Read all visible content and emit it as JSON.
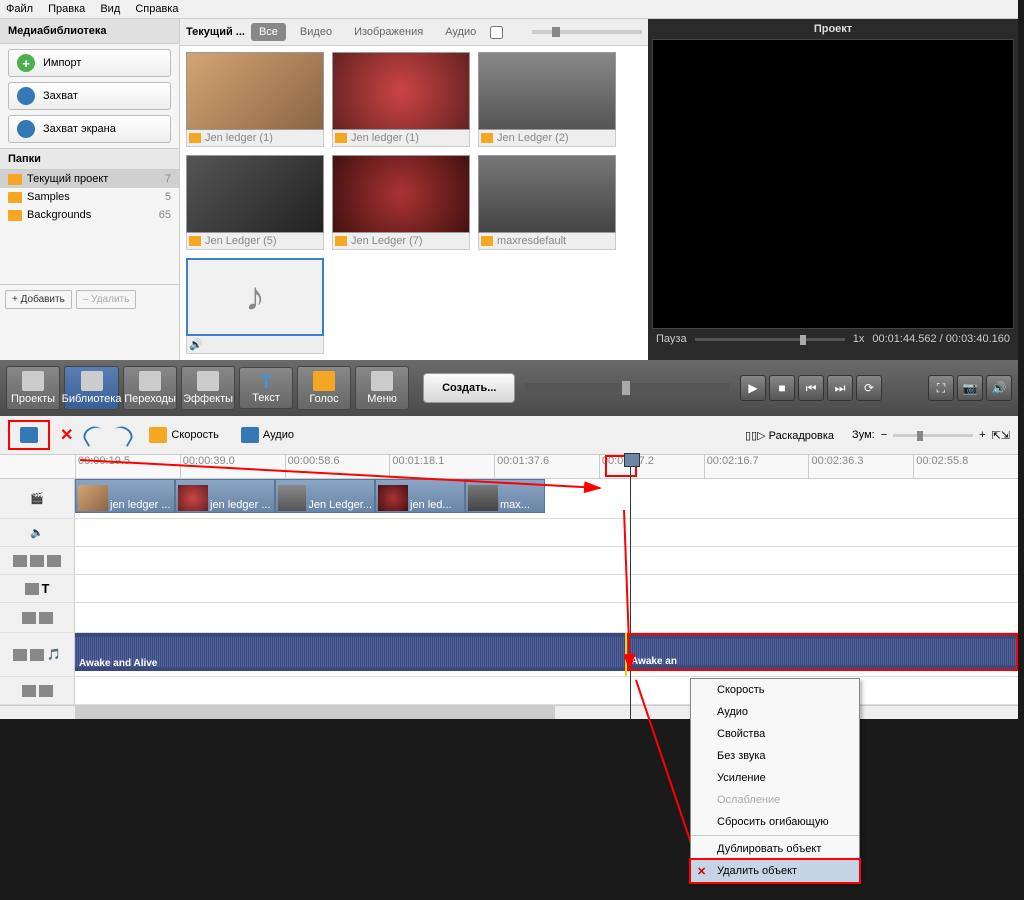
{
  "menubar": [
    "Файл",
    "Правка",
    "Вид",
    "Справка"
  ],
  "library": {
    "title": "Медиабиблиотека",
    "import": "Импорт",
    "capture": "Захват",
    "screen_capture": "Захват экрана",
    "folders_title": "Папки",
    "folders": [
      {
        "name": "Текущий проект",
        "count": "7",
        "sel": true
      },
      {
        "name": "Samples",
        "count": "5"
      },
      {
        "name": "Backgrounds",
        "count": "65"
      }
    ],
    "add": "+ Добавить",
    "del": "– Удалить"
  },
  "media_tabs": {
    "current": "Текущий ...",
    "all": "Все",
    "video": "Видео",
    "images": "Изображения",
    "audio": "Аудио"
  },
  "thumbs": [
    {
      "name": "Jen ledger (1)"
    },
    {
      "name": "Jen ledger (1)"
    },
    {
      "name": "Jen Ledger (2)"
    },
    {
      "name": "Jen Ledger (5)"
    },
    {
      "name": "Jen Ledger (7)"
    },
    {
      "name": "maxresdefault"
    }
  ],
  "preview": {
    "title": "Проект",
    "pause": "Пауза",
    "speed": "1x",
    "time": "00:01:44.562 / 00:03:40.160"
  },
  "toolbar": {
    "projects": "Проекты",
    "library": "Библиотека",
    "transitions": "Переходы",
    "effects": "Эффекты",
    "text": "Текст",
    "voice": "Голос",
    "menu": "Меню",
    "create": "Создать..."
  },
  "tl_toolbar": {
    "speed": "Скорость",
    "audio": "Аудио",
    "storyboard": "Раскадровка",
    "zoom": "Зум:"
  },
  "ruler": [
    "00:00:19.5",
    "00:00:39.0",
    "00:00:58.6",
    "00:01:18.1",
    "00:01:37.6",
    "00:01:57.2",
    "00:02:16.7",
    "00:02:36.3",
    "00:02:55.8"
  ],
  "clips": [
    "jen ledger ...",
    "jen ledger ...",
    "Jen Ledger...",
    "jen led...",
    "max..."
  ],
  "audio_track": {
    "name1": "Awake and Alive",
    "name2": "Awake an"
  },
  "context_menu": [
    {
      "label": "Скорость"
    },
    {
      "label": "Аудио"
    },
    {
      "label": "Свойства"
    },
    {
      "label": "Без звука"
    },
    {
      "label": "Усиление"
    },
    {
      "label": "Ослабление",
      "dis": true
    },
    {
      "label": "Сбросить огибающую"
    },
    {
      "sep": true
    },
    {
      "label": "Дублировать объект"
    },
    {
      "label": "Удалить объект",
      "sel": true
    }
  ]
}
